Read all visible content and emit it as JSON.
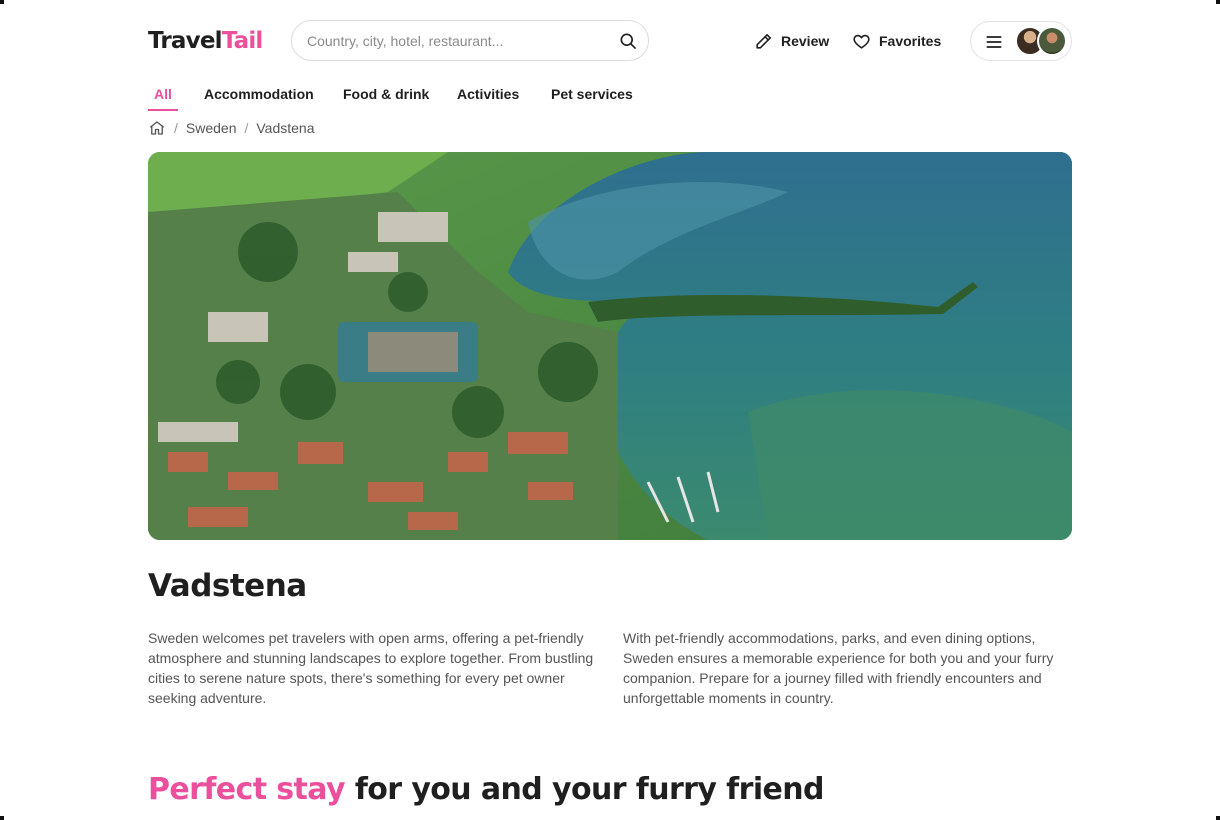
{
  "brand": {
    "name_part1": "Travel",
    "name_part2": "Tail",
    "accent_color": "#ec4f9c"
  },
  "search": {
    "placeholder": "Country, city, hotel, restaurant...",
    "value": ""
  },
  "header": {
    "review_label": "Review",
    "favorites_label": "Favorites"
  },
  "tabs": [
    {
      "label": "All",
      "active": true
    },
    {
      "label": "Accommodation",
      "active": false
    },
    {
      "label": "Food & drink",
      "active": false
    },
    {
      "label": "Activities",
      "active": false
    },
    {
      "label": "Pet services",
      "active": false
    }
  ],
  "breadcrumb": {
    "items": [
      "Sweden",
      "Vadstena"
    ]
  },
  "place": {
    "title": "Vadstena",
    "description_left": "Sweden welcomes pet travelers with open arms, offering a pet-friendly atmosphere and stunning landscapes to explore together. From bustling cities to serene nature spots, there's something for every pet owner seeking adventure.",
    "description_right": "With pet-friendly accommodations, parks, and even dining options, Sweden ensures a memorable experience for both you and your furry companion. Prepare for a journey filled with friendly encounters and unforgettable moments in country."
  },
  "section": {
    "title_accent": "Perfect stay",
    "title_rest": " for you and your furry friend"
  },
  "icons": [
    "home-icon",
    "search-icon",
    "pencil-icon",
    "heart-icon",
    "menu-icon"
  ]
}
